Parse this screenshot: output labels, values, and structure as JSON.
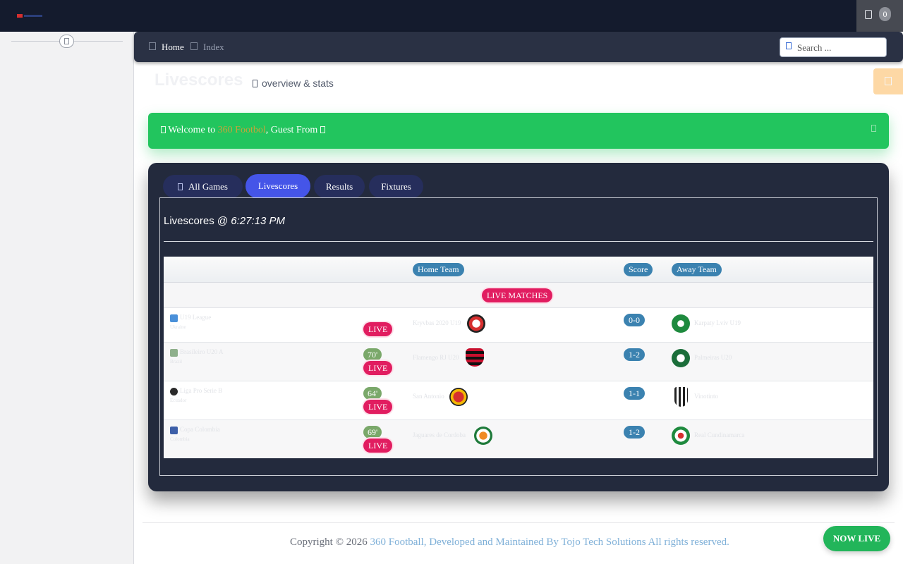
{
  "topbar": {
    "notification_count": "0"
  },
  "breadcrumb": {
    "home": "Home",
    "current": "Index"
  },
  "search": {
    "placeholder": "Search ..."
  },
  "page": {
    "title": "Livescores",
    "subtitle": "overview & stats"
  },
  "welcome": {
    "prefix": "Welcome to ",
    "brand": "360 Footbol",
    "suffix": ", Guest From "
  },
  "tabs": [
    {
      "label": "All Games"
    },
    {
      "label": "Livescores"
    },
    {
      "label": "Results"
    },
    {
      "label": "Fixtures"
    }
  ],
  "livescores": {
    "heading": "Livescores @ ",
    "time": "6:27:13 PM",
    "columns": {
      "home": "Home Team",
      "score": "Score",
      "away": "Away Team"
    },
    "section_label": "LIVE MATCHES",
    "matches": [
      {
        "league": "U19 League",
        "country": "Ukraine",
        "minute": "",
        "status": "LIVE",
        "home": "Kryvbas 2020 U19",
        "score": "0-0",
        "away": "Karpaty Lviv U19"
      },
      {
        "league": "Brasileiro U20 A",
        "country": "Brazil",
        "minute": "70'",
        "status": "LIVE",
        "home": "Flamengo RJ U20",
        "score": "1-2",
        "away": "Palmeiras U20"
      },
      {
        "league": "Liga Pro Serie B",
        "country": "Ecuador",
        "minute": "64'",
        "status": "LIVE",
        "home": "San Antonio",
        "score": "1-1",
        "away": "Vinotinto"
      },
      {
        "league": "Copa Colombia",
        "country": "Colombia",
        "minute": "69'",
        "status": "LIVE",
        "home": "Jaguares de Cordoba",
        "score": "1-2",
        "away": "Real Cundinamarca"
      }
    ]
  },
  "footer": {
    "copyright": "Copyright © 2026 ",
    "link": "360 Football, Developed and Maintained By Tojo Tech Solutions All rights reserved.",
    "now_live": "NOW LIVE"
  },
  "colors": {
    "accent": "#4555e8",
    "live": "#e11d60",
    "success": "#22c55e",
    "score": "#3b82b0"
  }
}
